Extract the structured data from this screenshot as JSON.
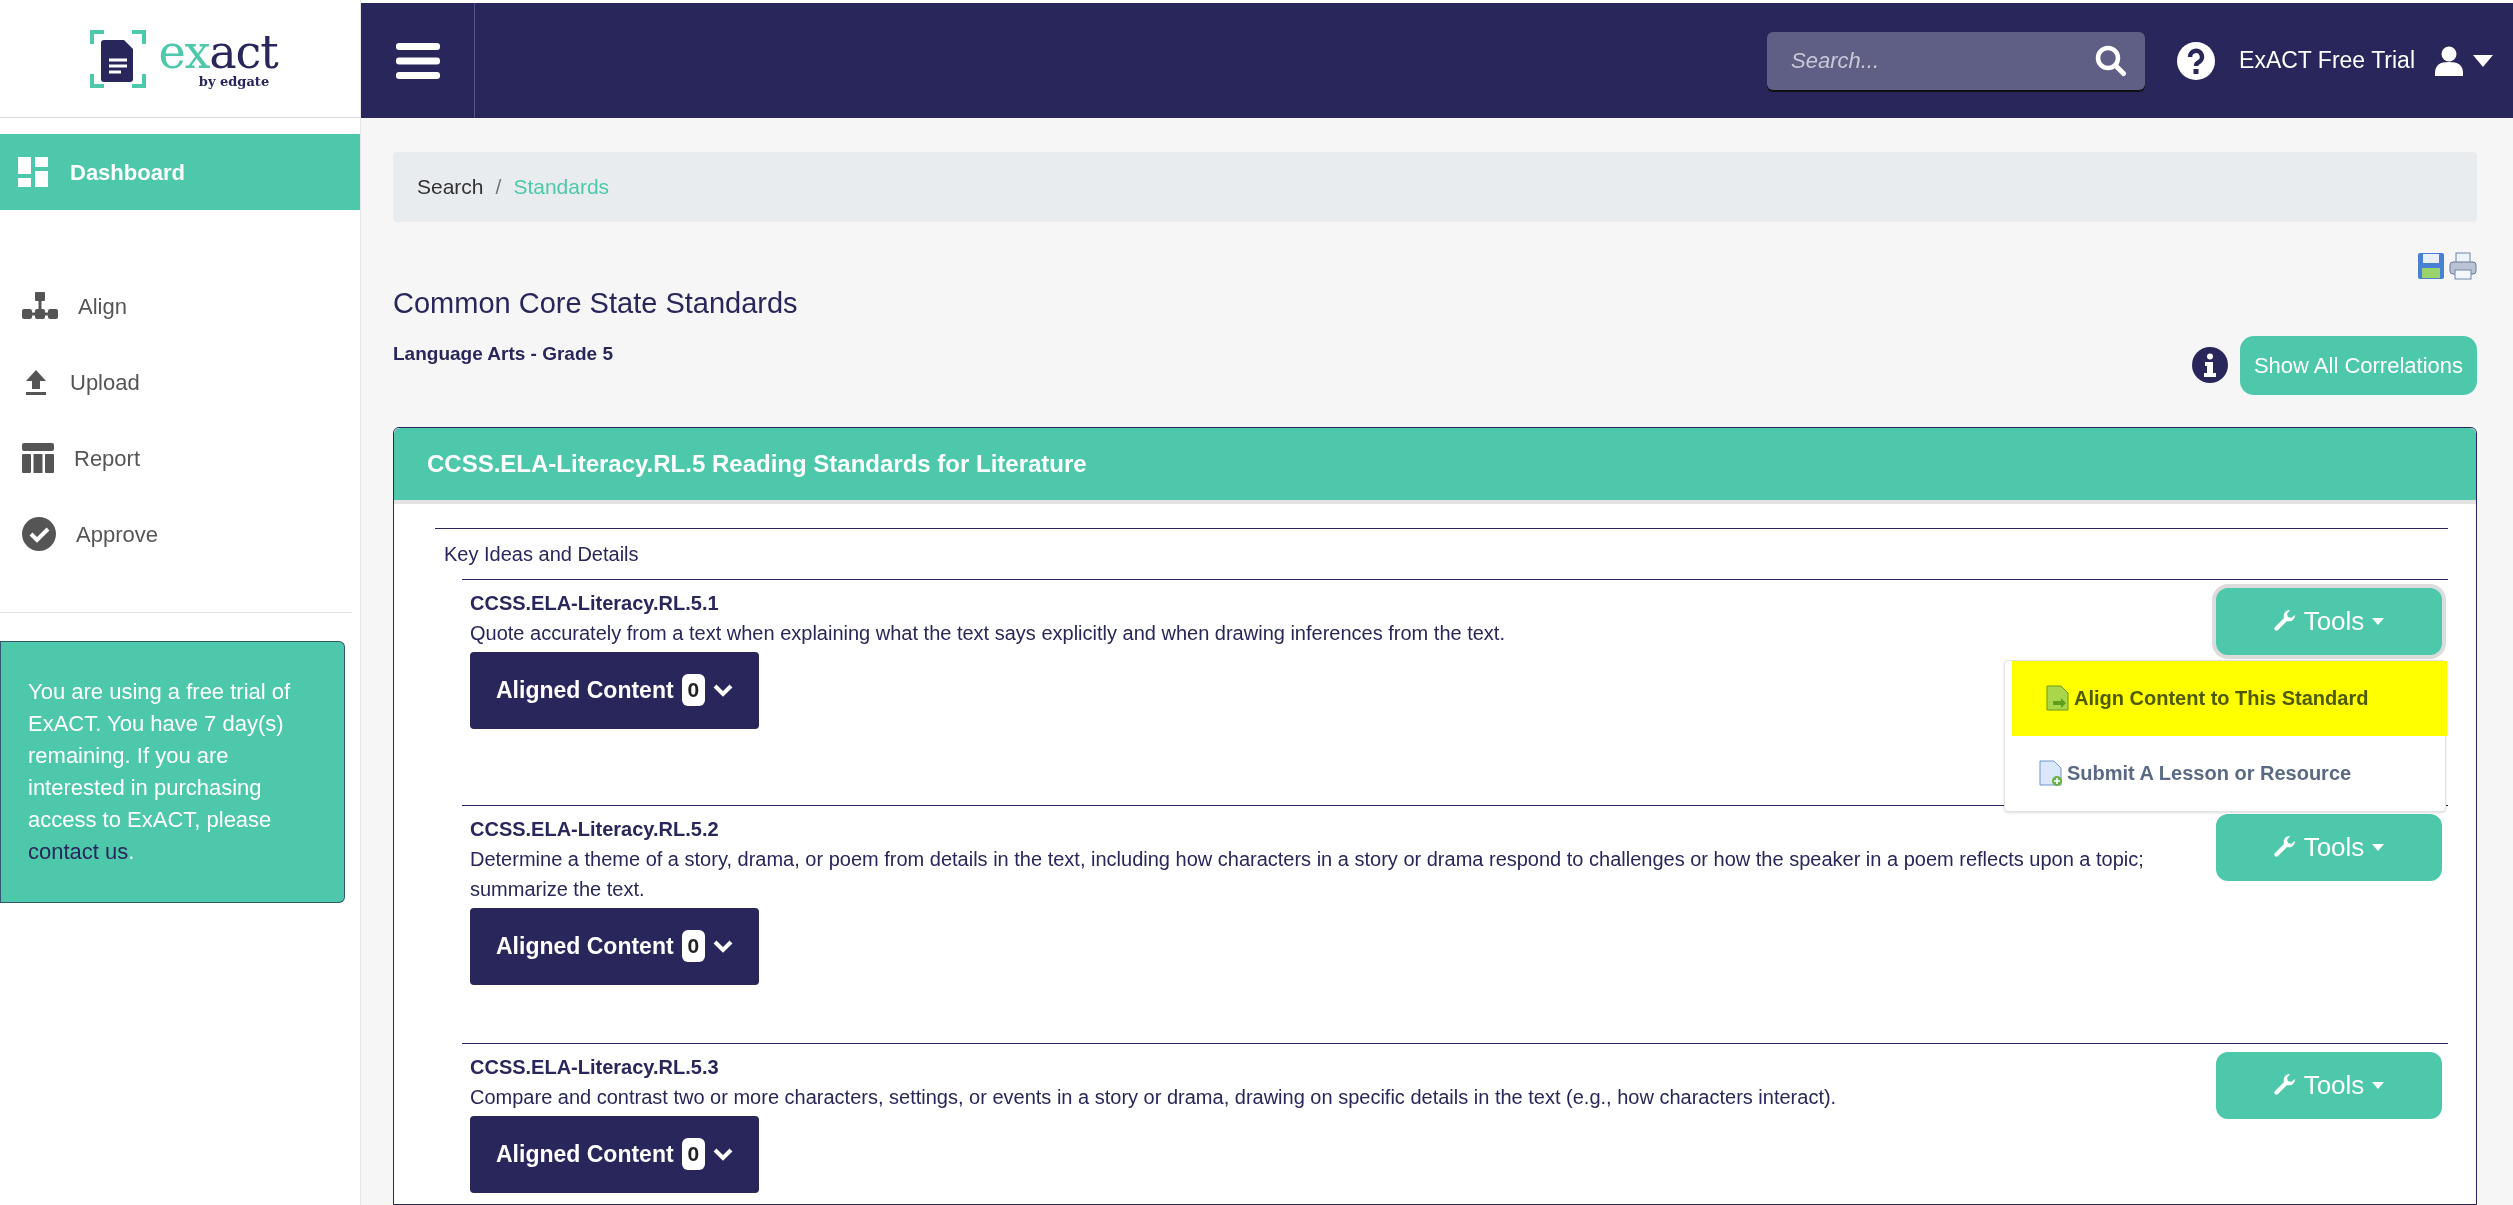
{
  "logo": {
    "parts": [
      "ex",
      "act"
    ],
    "tagline": "by edgate"
  },
  "sidebar": {
    "items": [
      {
        "label": "Dashboard",
        "selected": true
      },
      {
        "label": "Align",
        "selected": false
      },
      {
        "label": "Upload",
        "selected": false
      },
      {
        "label": "Report",
        "selected": false
      },
      {
        "label": "Approve",
        "selected": false
      }
    ],
    "trial_note": {
      "text": "You are using a free trial of ExACT. You have 7 day(s) remaining. If you are interested in purchasing access to ExACT, please ",
      "link": "contact us",
      "end": "."
    }
  },
  "header": {
    "search": {
      "placeholder": "Search..."
    },
    "user": "ExACT Free Trial"
  },
  "breadcrumb": {
    "separator": "/",
    "items": [
      {
        "label": "Search",
        "selected": false
      },
      {
        "label": "Standards",
        "selected": true
      }
    ]
  },
  "page": {
    "title": "Common Core State Standards",
    "subtitle": "Language Arts - Grade 5",
    "show_all_button": "Show All Correlations"
  },
  "panel": {
    "title": "**CCSS.ELA-Literacy.RL.5** Reading Standards for Literature",
    "group": "Key Ideas and Details",
    "standards": [
      {
        "code": "CCSS.ELA-Literacy.RL.5.1",
        "description": "Quote accurately from a text when explaining what the text says explicitly and when drawing inferences from the text.",
        "aligned_label": "Aligned Content",
        "aligned_count": "0",
        "tools_label": "Tools",
        "tools_expanded": true
      },
      {
        "code": "CCSS.ELA-Literacy.RL.5.2",
        "description": "Determine a theme of a story, drama, or poem from details in the text, including how characters in a story or drama respond to challenges or how the speaker in a poem reflects upon a topic; summarize the text.",
        "aligned_label": "Aligned Content",
        "aligned_count": "0",
        "tools_label": "Tools",
        "tools_expanded": false
      },
      {
        "code": "CCSS.ELA-Literacy.RL.5.3",
        "description": "Compare and contrast two or more characters, settings, or events in a story or drama, drawing on specific details in the text (e.g., how characters interact).",
        "aligned_label": "Aligned Content",
        "aligned_count": "0",
        "tools_label": "Tools",
        "tools_expanded": false
      }
    ],
    "tools_menu": [
      {
        "label": "Align Content to This Standard",
        "selected": true
      },
      {
        "label": "Submit A Lesson or Resource",
        "selected": false
      }
    ]
  }
}
